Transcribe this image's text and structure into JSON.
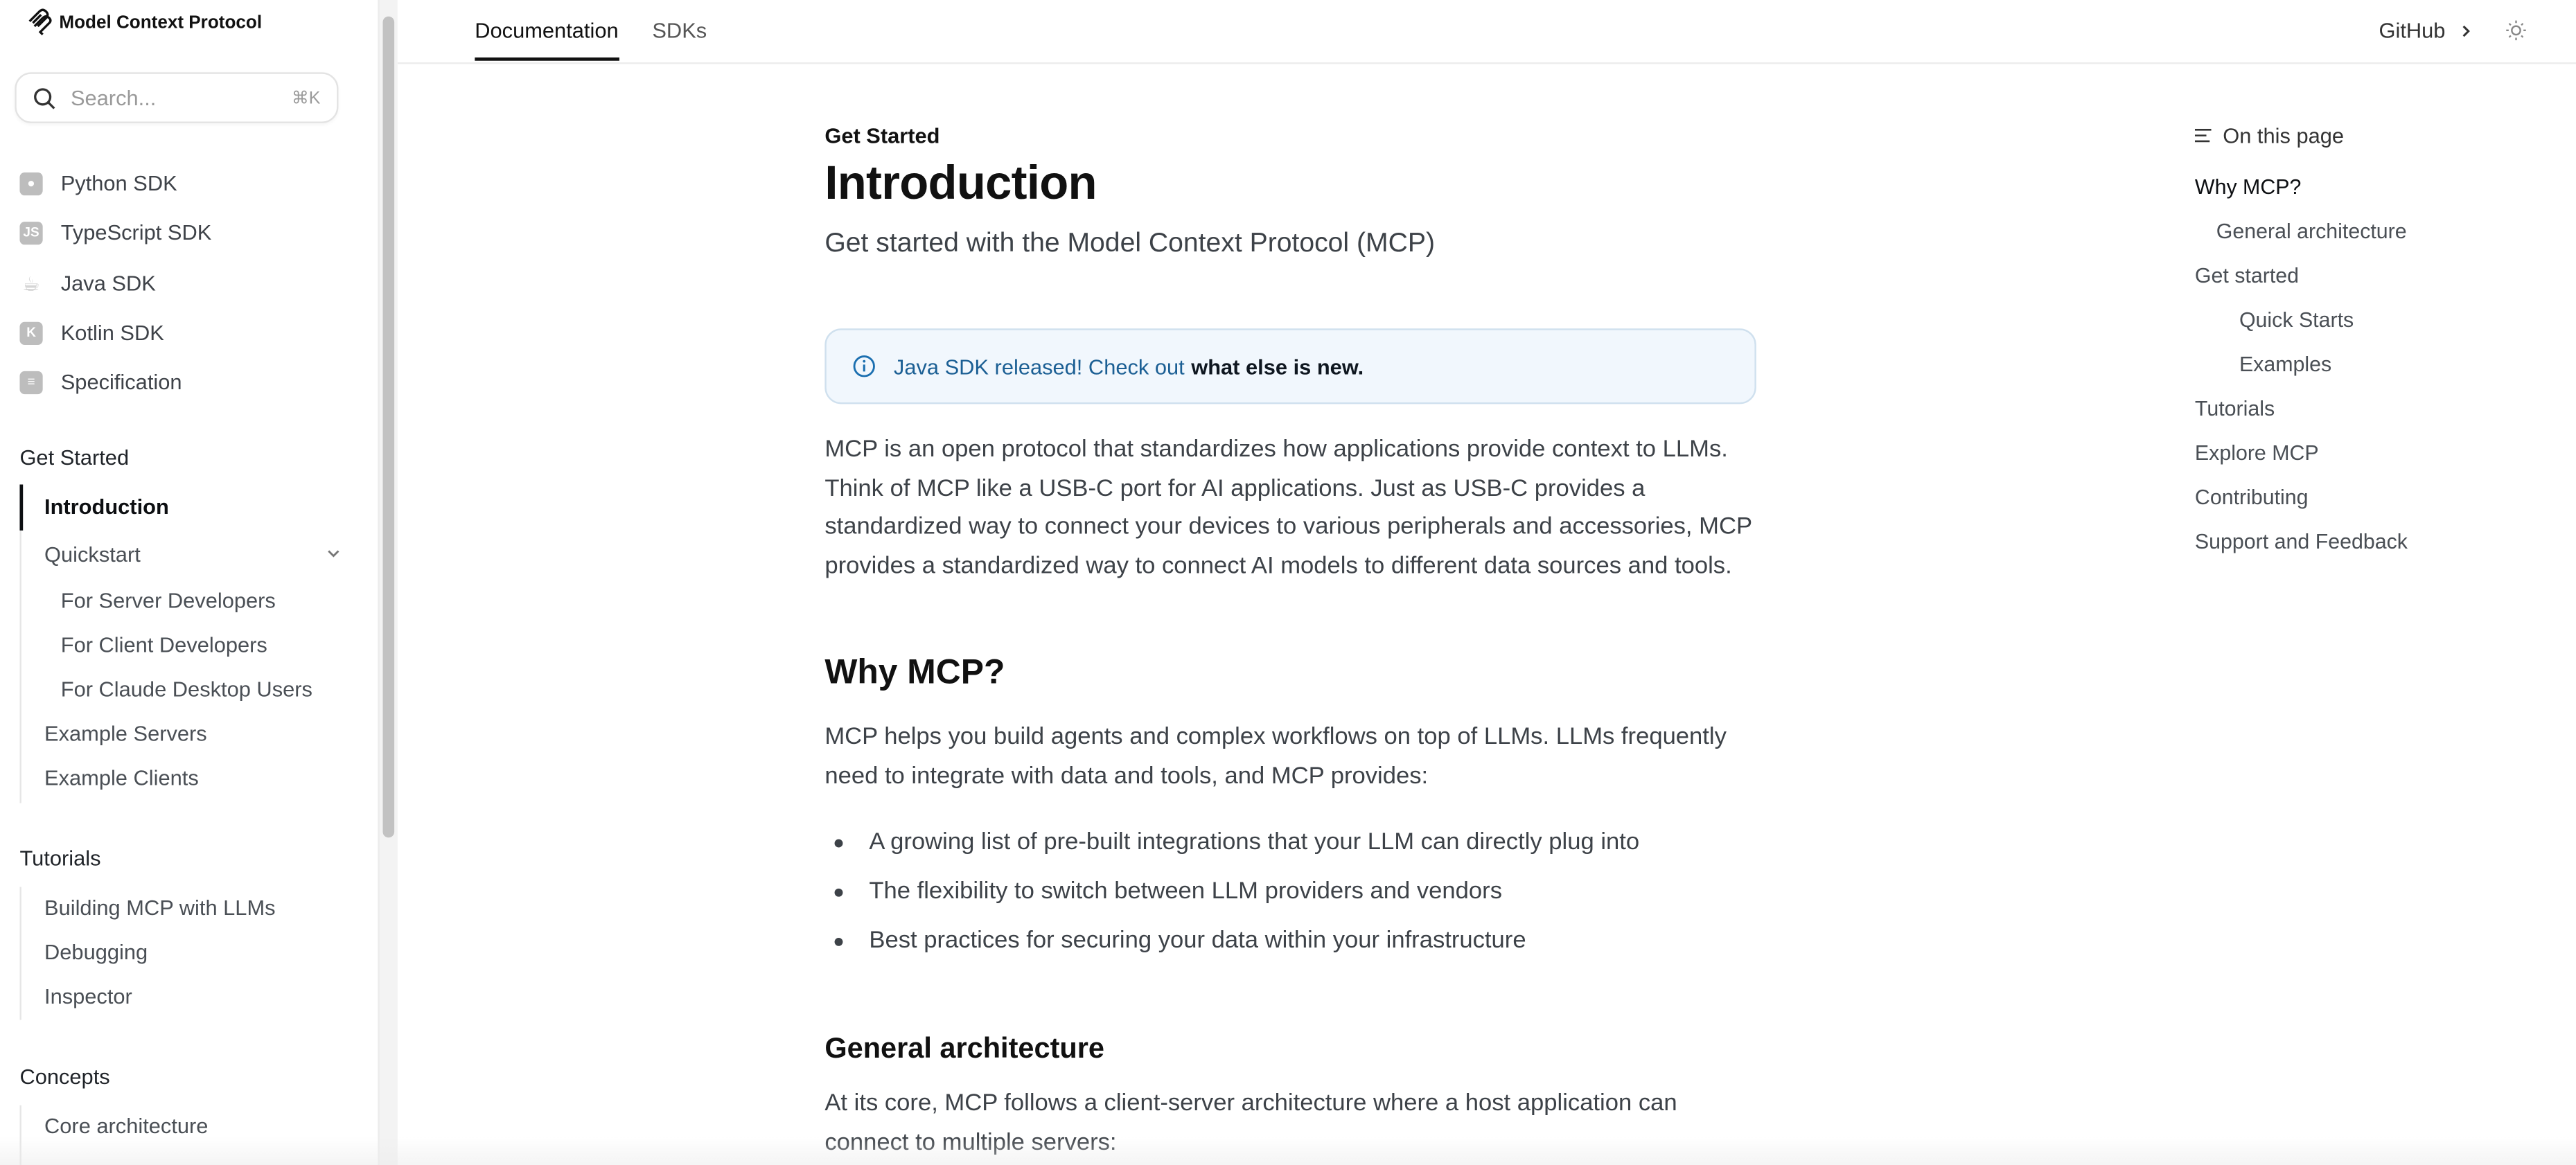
{
  "brand": {
    "name": "Model Context Protocol"
  },
  "search": {
    "placeholder": "Search...",
    "shortcut": "⌘K"
  },
  "sdks": [
    {
      "label": "Python SDK",
      "icon": "python-icon"
    },
    {
      "label": "TypeScript SDK",
      "icon": "typescript-icon"
    },
    {
      "label": "Java SDK",
      "icon": "java-icon"
    },
    {
      "label": "Kotlin SDK",
      "icon": "kotlin-icon"
    },
    {
      "label": "Specification",
      "icon": "book-icon"
    }
  ],
  "sidebar": {
    "get_started": {
      "title": "Get Started",
      "items": [
        "Introduction",
        "Quickstart",
        "For Server Developers",
        "For Client Developers",
        "For Claude Desktop Users",
        "Example Servers",
        "Example Clients"
      ]
    },
    "tutorials": {
      "title": "Tutorials",
      "items": [
        "Building MCP with LLMs",
        "Debugging",
        "Inspector"
      ]
    },
    "concepts": {
      "title": "Concepts",
      "items": [
        "Core architecture"
      ]
    }
  },
  "topbar": {
    "tabs": [
      "Documentation",
      "SDKs"
    ],
    "github": "GitHub"
  },
  "page": {
    "eyebrow": "Get Started",
    "title": "Introduction",
    "subtitle": "Get started with the Model Context Protocol (MCP)",
    "callout": {
      "text": "Java SDK released! Check out",
      "link": "what else is new."
    },
    "intro": "MCP is an open protocol that standardizes how applications provide context to LLMs. Think of MCP like a USB-C port for AI applications. Just as USB-C provides a standardized way to connect your devices to various peripherals and accessories, MCP provides a standardized way to connect AI models to different data sources and tools.",
    "why_heading": "Why MCP?",
    "why_text": "MCP helps you build agents and complex workflows on top of LLMs. LLMs frequently need to integrate with data and tools, and MCP provides:",
    "bullets": [
      "A growing list of pre-built integrations that your LLM can directly plug into",
      "The flexibility to switch between LLM providers and vendors",
      "Best practices for securing your data within your infrastructure"
    ],
    "arch_heading": "General architecture",
    "arch_text": "At its core, MCP follows a client-server architecture where a host application can connect to multiple servers:"
  },
  "toc": {
    "title": "On this page",
    "items": [
      "Why MCP?",
      "General architecture",
      "Get started",
      "Quick Starts",
      "Examples",
      "Tutorials",
      "Explore MCP",
      "Contributing",
      "Support and Feedback"
    ]
  }
}
